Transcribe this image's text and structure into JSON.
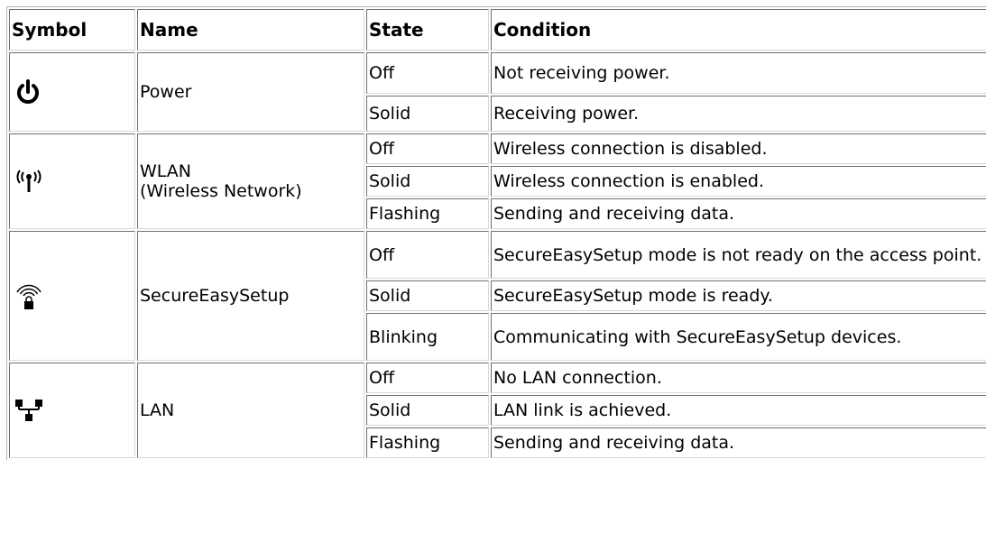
{
  "headers": {
    "symbol": "Symbol",
    "name": "Name",
    "state": "State",
    "condition": "Condition"
  },
  "groups": [
    {
      "icon": "power-icon",
      "name": "Power",
      "rows": [
        {
          "state": "Off",
          "condition": "Not receiving power."
        },
        {
          "state": "Solid",
          "condition": "Receiving power."
        }
      ]
    },
    {
      "icon": "wireless-antenna-icon",
      "name_line1": "WLAN",
      "name_line2": "(Wireless Network)",
      "rows": [
        {
          "state": "Off",
          "condition": "Wireless connection is disabled."
        },
        {
          "state": "Solid",
          "condition": "Wireless connection is enabled."
        },
        {
          "state": "Flashing",
          "condition": "Sending and receiving data."
        }
      ]
    },
    {
      "icon": "secure-easy-setup-lock-icon",
      "name": "SecureEasySetup",
      "rows": [
        {
          "state": "Off",
          "condition": "SecureEasySetup mode is not ready on the access point."
        },
        {
          "state": "Solid",
          "condition": "SecureEasySetup mode is ready."
        },
        {
          "state": "Blinking",
          "condition": "Communicating with SecureEasySetup devices."
        }
      ]
    },
    {
      "icon": "lan-network-icon",
      "name": "LAN",
      "rows": [
        {
          "state": "Off",
          "condition": "No LAN connection."
        },
        {
          "state": "Solid",
          "condition": "LAN link is achieved."
        },
        {
          "state": "Flashing",
          "condition": "Sending and receiving data."
        }
      ]
    }
  ]
}
